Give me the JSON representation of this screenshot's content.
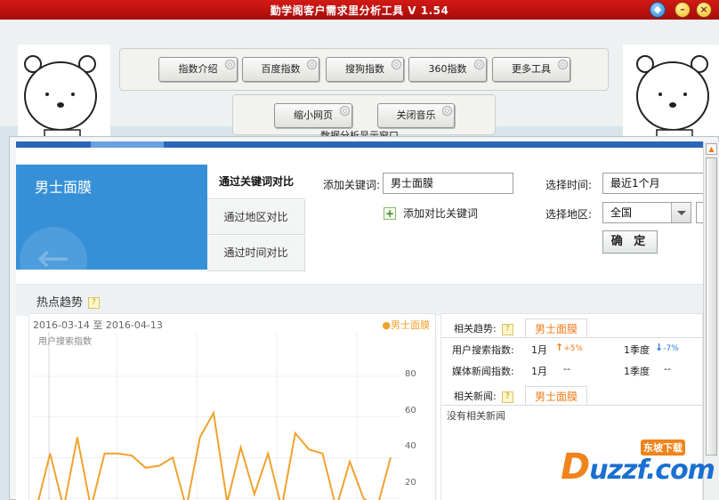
{
  "app": {
    "title": "勤学阁客户需求里分析工具 V 1.54"
  },
  "toolbar": {
    "row1": [
      "指数介绍",
      "百度指数",
      "搜狗指数",
      "360指数",
      "更多工具"
    ],
    "row2": [
      "缩小网页",
      "关闭音乐"
    ]
  },
  "section_label": "数据分析显示窗口",
  "keyword_panel": {
    "keyword": "男士面膜",
    "compare_tabs": [
      "通过关键词对比",
      "通过地区对比",
      "通过时间对比"
    ],
    "active_tab": 0
  },
  "form": {
    "add_keyword_label": "添加关键词:",
    "add_keyword_value": "男士面膜",
    "add_compare_link": "添加对比关键词",
    "time_label": "选择时间:",
    "time_value": "最近1个月",
    "region_label": "选择地区:",
    "region_value": "全国",
    "confirm_label": "确 定"
  },
  "hot_trend": {
    "title": "热点趋势"
  },
  "chart_data": {
    "type": "line",
    "date_range": "2016-03-14 至 2016-04-13",
    "legend": "●男士面膜",
    "ylabel": "用户搜索指数",
    "yticks": [
      80,
      60,
      40,
      20
    ],
    "series": [
      {
        "name": "男士面膜",
        "color": "#f0a22e",
        "values": [
          0,
          42,
          0,
          50,
          10,
          42,
          42,
          41,
          35,
          36,
          40,
          0,
          50,
          62,
          18,
          45,
          22,
          42,
          0,
          52,
          44,
          42,
          2,
          38,
          20,
          0,
          40
        ]
      }
    ]
  },
  "related": {
    "trend_label": "相关趋势:",
    "trend_tag": "男士面膜",
    "rows": [
      {
        "label": "用户搜索指数:",
        "month": "1月",
        "month_change": "+5%",
        "quarter": "1季度",
        "quarter_change": "-7%"
      },
      {
        "label": "媒体新闻指数:",
        "month": "1月",
        "month_value": "--",
        "quarter": "1季度",
        "quarter_value": "--"
      }
    ],
    "news_label": "相关新闻:",
    "news_tag": "男士面膜",
    "no_news": "没有相关新闻"
  },
  "watermark": {
    "text": "uzzf.com",
    "badge": "东坡下载"
  }
}
